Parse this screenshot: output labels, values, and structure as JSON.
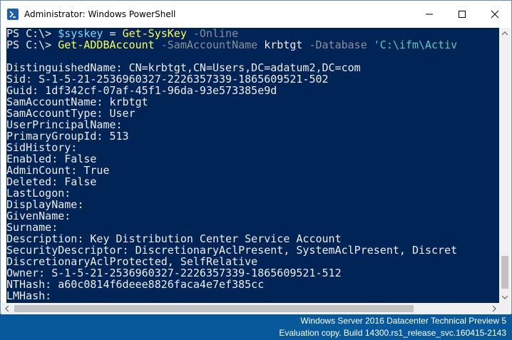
{
  "window": {
    "title": "Administrator: Windows PowerShell",
    "minimize_icon": "minimize-icon",
    "maximize_icon": "maximize-icon",
    "close_icon": "close-icon"
  },
  "console": {
    "lines": [
      [
        {
          "t": "PS C:\\> ",
          "c": "plain"
        },
        {
          "t": "$syskey",
          "c": "var"
        },
        {
          "t": " = ",
          "c": "plain"
        },
        {
          "t": "Get-SysKey",
          "c": "cmd"
        },
        {
          "t": " -Online",
          "c": "param"
        }
      ],
      [
        {
          "t": "PS C:\\> ",
          "c": "plain"
        },
        {
          "t": "Get-ADDBAccount",
          "c": "cmd"
        },
        {
          "t": " -SamAccountName ",
          "c": "param"
        },
        {
          "t": "krbtgt",
          "c": "plain"
        },
        {
          "t": " -Database ",
          "c": "param"
        },
        {
          "t": "'C:\\ifm\\Activ",
          "c": "str"
        }
      ],
      [
        {
          "t": "",
          "c": "plain"
        }
      ],
      [
        {
          "t": "DistinguishedName: CN=krbtgt,CN=Users,DC=adatum2,DC=com",
          "c": "plain"
        }
      ],
      [
        {
          "t": "Sid: S-1-5-21-2536960327-2226357339-1865609521-502",
          "c": "plain"
        }
      ],
      [
        {
          "t": "Guid: 1df342cf-07af-45f1-96da-93e573385e9d",
          "c": "plain"
        }
      ],
      [
        {
          "t": "SamAccountName: krbtgt",
          "c": "plain"
        }
      ],
      [
        {
          "t": "SamAccountType: User",
          "c": "plain"
        }
      ],
      [
        {
          "t": "UserPrincipalName:",
          "c": "plain"
        }
      ],
      [
        {
          "t": "PrimaryGroupId: 513",
          "c": "plain"
        }
      ],
      [
        {
          "t": "SidHistory:",
          "c": "plain"
        }
      ],
      [
        {
          "t": "Enabled: False",
          "c": "plain"
        }
      ],
      [
        {
          "t": "AdminCount: True",
          "c": "plain"
        }
      ],
      [
        {
          "t": "Deleted: False",
          "c": "plain"
        }
      ],
      [
        {
          "t": "LastLogon:",
          "c": "plain"
        }
      ],
      [
        {
          "t": "DisplayName:",
          "c": "plain"
        }
      ],
      [
        {
          "t": "GivenName:",
          "c": "plain"
        }
      ],
      [
        {
          "t": "Surname:",
          "c": "plain"
        }
      ],
      [
        {
          "t": "Description: Key Distribution Center Service Account",
          "c": "plain"
        }
      ],
      [
        {
          "t": "SecurityDescriptor: DiscretionaryAclPresent, SystemAclPresent, Discret",
          "c": "plain"
        }
      ],
      [
        {
          "t": "DiscretionaryAclProtected, SelfRelative",
          "c": "plain"
        }
      ],
      [
        {
          "t": "Owner: S-1-5-21-2536960327-2226357339-1865609521-512",
          "c": "plain"
        }
      ],
      [
        {
          "t": "NTHash: a60c0814f6deee8826faca4e7ef385cc",
          "c": "plain"
        }
      ],
      [
        {
          "t": "LMHash:",
          "c": "plain"
        }
      ]
    ]
  },
  "colors": {
    "console_bg": "#012456",
    "desktop_bg": "#08599c"
  },
  "watermark": {
    "line1": "Windows Server 2016 Datacenter Technical Preview 5",
    "line2": "Evaluation copy. Build 14300.rs1_release_svc.160415-2143"
  }
}
